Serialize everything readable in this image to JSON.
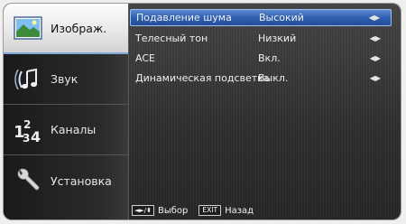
{
  "sidebar": {
    "items": [
      {
        "label": "Изображ.",
        "icon": "picture-icon"
      },
      {
        "label": "Звук",
        "icon": "music-note-icon"
      },
      {
        "label": "Каналы",
        "icon": "channel-numbers-icon"
      },
      {
        "label": "Установка",
        "icon": "wrench-icon"
      }
    ]
  },
  "menu": {
    "rows": [
      {
        "name": "Подавление шума",
        "value": "Высокий"
      },
      {
        "name": "Телесный тон",
        "value": "Низкий"
      },
      {
        "name": "ACE",
        "value": "Вкл."
      },
      {
        "name": "Динамическая подсветка",
        "value": "Выкл."
      }
    ]
  },
  "footer": {
    "nav_key": "◄►/⬍",
    "nav_label": "Выбор",
    "exit_key": "EXIT",
    "exit_label": "Назад"
  },
  "colors": {
    "highlight": "#2f5fb0",
    "panel_bg": "#2e2e2e",
    "active_tab_bg": "#e9e9e9"
  }
}
